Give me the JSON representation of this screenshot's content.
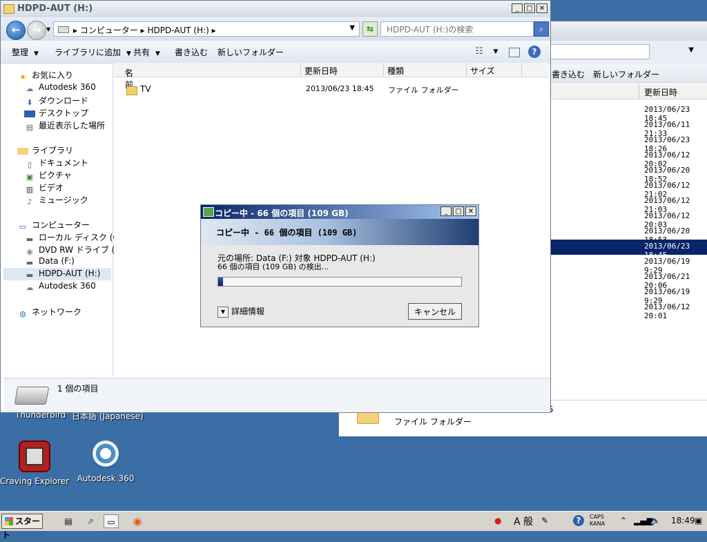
{
  "main_window": {
    "title": "HDPD-AUT (H:)",
    "address_path": "▸ コンピューター ▸ HDPD-AUT (H:) ▸",
    "search_placeholder": "HDPD-AUT (H:)の検索",
    "toolbar": {
      "organize": "整理",
      "add_to_library": "ライブラリに追加",
      "share": "共有",
      "burn": "書き込む",
      "new_folder": "新しいフォルダー"
    },
    "nav": {
      "favorites": "お気に入り",
      "fav_items": [
        "Autodesk 360",
        "ダウンロード",
        "デスクトップ",
        "最近表示した場所"
      ],
      "libraries": "ライブラリ",
      "lib_items": [
        "ドキュメント",
        "ピクチャ",
        "ビデオ",
        "ミュージック"
      ],
      "computer": "コンピューター",
      "comp_items": [
        "ローカル ディスク (C:)",
        "DVD RW ドライブ (E:)",
        "Data (F:)",
        "HDPD-AUT (H:)",
        "Autodesk 360"
      ],
      "network": "ネットワーク"
    },
    "columns": {
      "name": "名前",
      "modified": "更新日時",
      "type": "種類",
      "size": "サイズ"
    },
    "files": [
      {
        "name": "TV",
        "modified": "2013/06/23 18:45",
        "type": "ファイル フォルダー",
        "size": ""
      }
    ],
    "details_count": "1 個の項目"
  },
  "copy_dialog": {
    "title": "コピー中 - 66 個の項目 (109 GB)",
    "banner": "コピー中 - 66 個の項目 (109 GB)",
    "source_line": "元の場所: Data (F:) 対象 HDPD-AUT (H:)",
    "status_line": "66 個の項目 (109 GB) の検出...",
    "progress": 0.02,
    "more_info": "詳細情報",
    "cancel": "キャンセル"
  },
  "bg_window": {
    "toolbar": {
      "burn": "書き込む",
      "new_folder": "新しいフォルダー"
    },
    "column_modified": "更新日時",
    "dates": [
      "2013/06/23 18:45",
      "2013/06/11 21:33",
      "2013/06/23 18:26",
      "2013/06/12 20:02",
      "2013/06/20 18:52",
      "2013/06/12 21:02",
      "2013/06/12 21:03",
      "2013/06/12 20:03",
      "2013/06/20 18:53",
      "2013/06/23 18:45",
      "2013/06/19 9:29",
      "2013/06/21 20:06",
      "2013/06/19 9:29",
      "2013/06/12 20:01"
    ],
    "selected_index": 9,
    "bottom_type": "ファイル フォルダー",
    "bottom_partial": "5"
  },
  "desktop": {
    "behind_labels": [
      "Thunderbird",
      "日本語 (Japanese)"
    ],
    "icons": [
      {
        "label": "Craving Explorer"
      },
      {
        "label": "Autodesk 360"
      }
    ]
  },
  "taskbar": {
    "start": "スタート",
    "ime": "A 般",
    "caps": "CAPS",
    "kana": "KANA",
    "clock": "18:49"
  },
  "colors": {
    "selection": "#0a246a",
    "desktop": "#3a6ea5"
  }
}
